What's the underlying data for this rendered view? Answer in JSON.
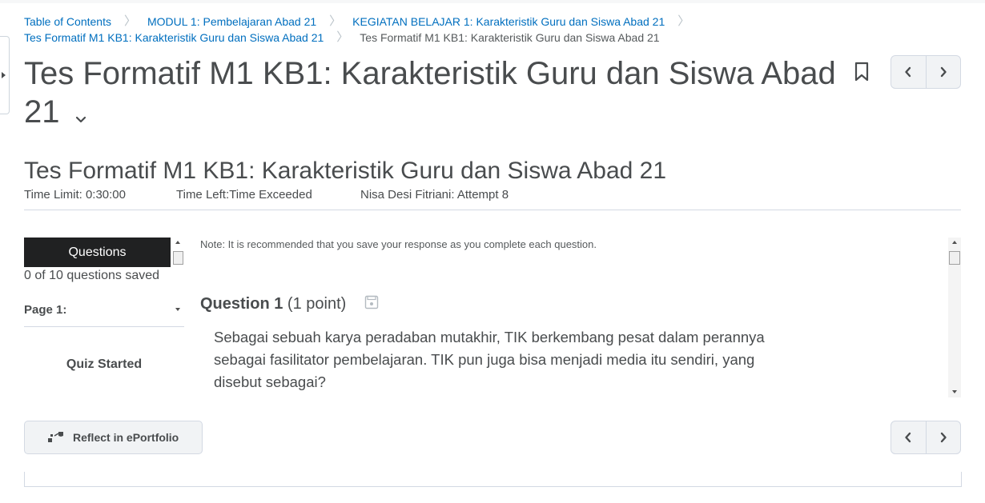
{
  "breadcrumb": {
    "items": [
      "Table of Contents",
      "MODUL 1: Pembelajaran Abad 21",
      "KEGIATAN BELAJAR 1: Karakteristik Guru dan Siswa Abad 21",
      "Tes Formatif M1 KB1: Karakteristik Guru dan Siswa Abad 21"
    ],
    "current": "Tes Formatif M1 KB1: Karakteristik Guru dan Siswa Abad 21"
  },
  "page": {
    "title": "Tes Formatif M1 KB1: Karakteristik Guru dan Siswa Abad 21",
    "title_line2": "21"
  },
  "quiz": {
    "title": "Tes Formatif M1 KB1: Karakteristik Guru dan Siswa Abad 21",
    "time_limit": "Time Limit: 0:30:00",
    "time_left": "Time Left:Time Exceeded",
    "attempt": "Nisa Desi Fitriani: Attempt 8"
  },
  "sidebar": {
    "header": "Questions",
    "saved": "0 of 10 questions saved",
    "page_label": "Page 1:",
    "status": "Quiz Started"
  },
  "main": {
    "note": "Note: It is recommended that you save your response as you complete each question.",
    "question_label": "Question 1",
    "question_points": "(1 point)",
    "question_text": "Sebagai sebuah karya peradaban mutakhir, TIK berkembang pesat dalam perannya sebagai fasilitator pembelajaran. TIK pun juga bisa menjadi media itu sendiri, yang disebut sebagai?"
  },
  "footer": {
    "reflect_label": "Reflect in ePortfolio"
  },
  "icons": {
    "bookmark": "bookmark-icon",
    "prev": "chevron-left-icon",
    "next": "chevron-right-icon",
    "expand": "chevron-down-icon",
    "save": "save-icon",
    "reflect": "eportfolio-icon"
  },
  "colors": {
    "link": "#006fbf",
    "text": "#494c4e",
    "header_bg": "#202122",
    "button_bg": "#f1f3f5",
    "border": "#d3d9e3"
  }
}
